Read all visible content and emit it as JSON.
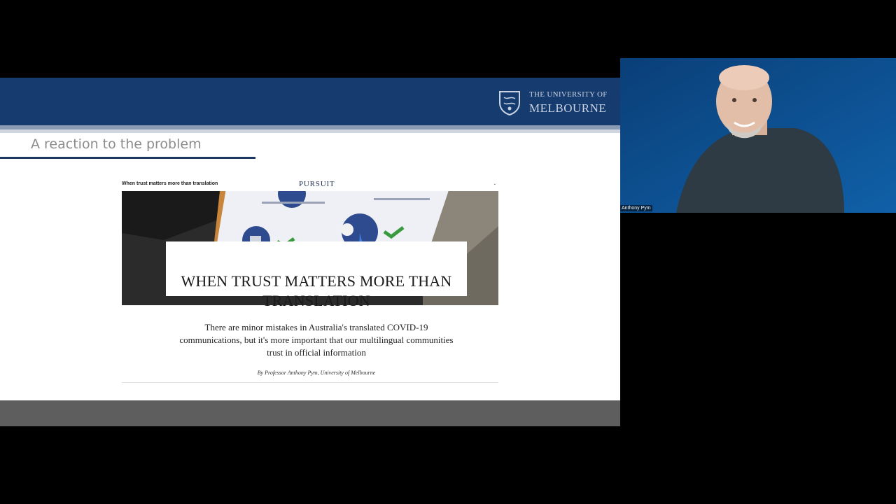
{
  "slide": {
    "university_line1": "THE UNIVERSITY OF",
    "university_line2": "MELBOURNE",
    "title": "A reaction to the problem",
    "article": {
      "topline": "When trust matters more than translation",
      "brand": "PURSUIT",
      "headline": "WHEN TRUST MATTERS MORE THAN TRANSLATION",
      "dek": "There are minor mistakes in Australia's translated COVID-19 communications, but it's more important that our multilingual communities trust in official information",
      "byline": "By Professor Anthony Pym, University of Melbourne"
    }
  },
  "webcam": {
    "participant_name": "Anthony Pym"
  },
  "colors": {
    "header_blue": "#163b6e",
    "webcam_bg": "#0e4b86",
    "footer_gray": "#5e5e5e"
  }
}
